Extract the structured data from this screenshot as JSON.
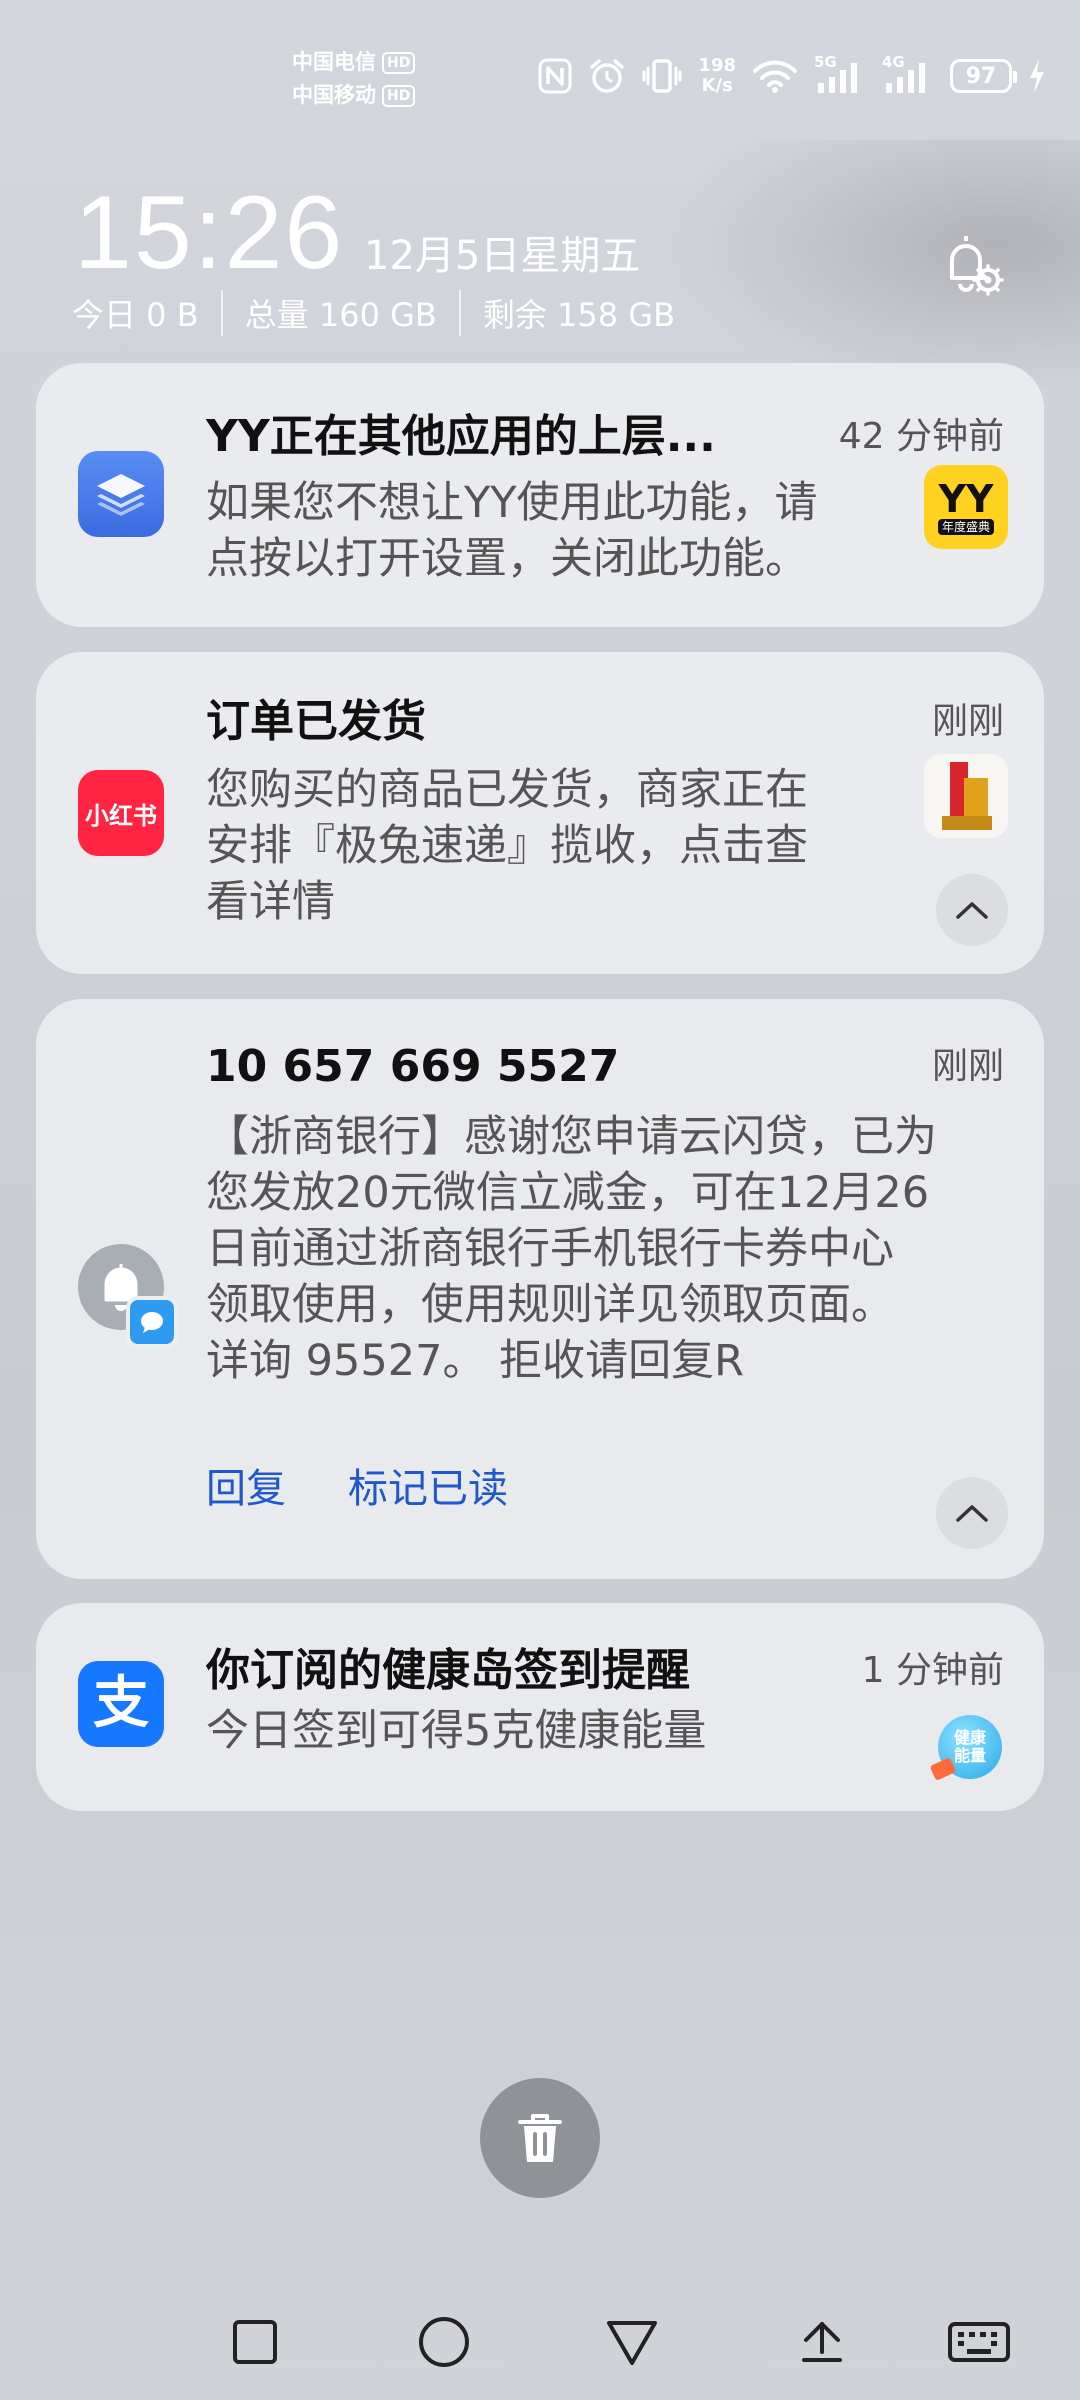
{
  "status_bar": {
    "carrier_1": "中国电信",
    "carrier_2": "中国移动",
    "hd_label": "HD",
    "speed_value": "198",
    "speed_unit": "K/s",
    "network_5g": "5G",
    "network_4g": "4G",
    "battery_level": "97",
    "icons": [
      "nfc-icon",
      "alarm-icon",
      "vibrate-icon",
      "wifi-icon",
      "signal-5g-icon",
      "signal-4g-icon",
      "battery-icon",
      "charging-icon"
    ]
  },
  "header": {
    "time": "15:26",
    "date": "12月5日星期五",
    "storage_today": "今日 0 B",
    "storage_total": "总量 160 GB",
    "storage_free": "剩余 158 GB",
    "settings_icon": "notification-settings-icon"
  },
  "notifications": [
    {
      "app_icon": "overlay-layers-icon",
      "title": "YY正在其他应用的上层...",
      "time": "42 分钟前",
      "body_line_1": "如果您不想让YY使用此功能，请",
      "body_line_2": "点按以打开设置，关闭此功能。",
      "thumb_text": "YY",
      "thumb_caption": "年度盛典",
      "thumb_color": "#ffd21f"
    },
    {
      "app_icon": "xiaohongshu-icon",
      "app_icon_text": "小红书",
      "app_icon_color": "#ff2442",
      "title": "订单已发货",
      "time": "刚刚",
      "body_line_1": "您购买的商品已发货，商家正在",
      "body_line_2": "安排『极兔速递』揽收，点击查",
      "body_line_3": "看详情",
      "collapse_icon": "chevron-up-icon"
    },
    {
      "app_icon": "messages-bell-icon",
      "title": "10 657 669 5527",
      "time": "刚刚",
      "body_line_1": "【浙商银行】感谢您申请云闪贷，已为",
      "body_line_2": "您发放20元微信立减金，可在12月26",
      "body_line_3": "日前通过浙商银行手机银行卡券中心",
      "body_line_4": "领取使用，使用规则详见领取页面。",
      "body_line_5": "详询 95527。 拒收请回复R",
      "action_reply": "回复",
      "action_mark_read": "标记已读",
      "collapse_icon": "chevron-up-icon"
    },
    {
      "app_icon": "alipay-icon",
      "app_icon_text": "支",
      "app_icon_color": "#1677ff",
      "title": "你订阅的健康岛签到提醒",
      "time": "1 分钟前",
      "body_line_1": "今日签到可得5克健康能量",
      "thumb_line_1": "健康",
      "thumb_line_2": "能量"
    }
  ],
  "bottom": {
    "clear_icon": "trash-icon"
  },
  "nav": {
    "icons": [
      "recent-apps-icon",
      "home-icon",
      "back-icon",
      "pin-icon",
      "keyboard-icon"
    ]
  }
}
